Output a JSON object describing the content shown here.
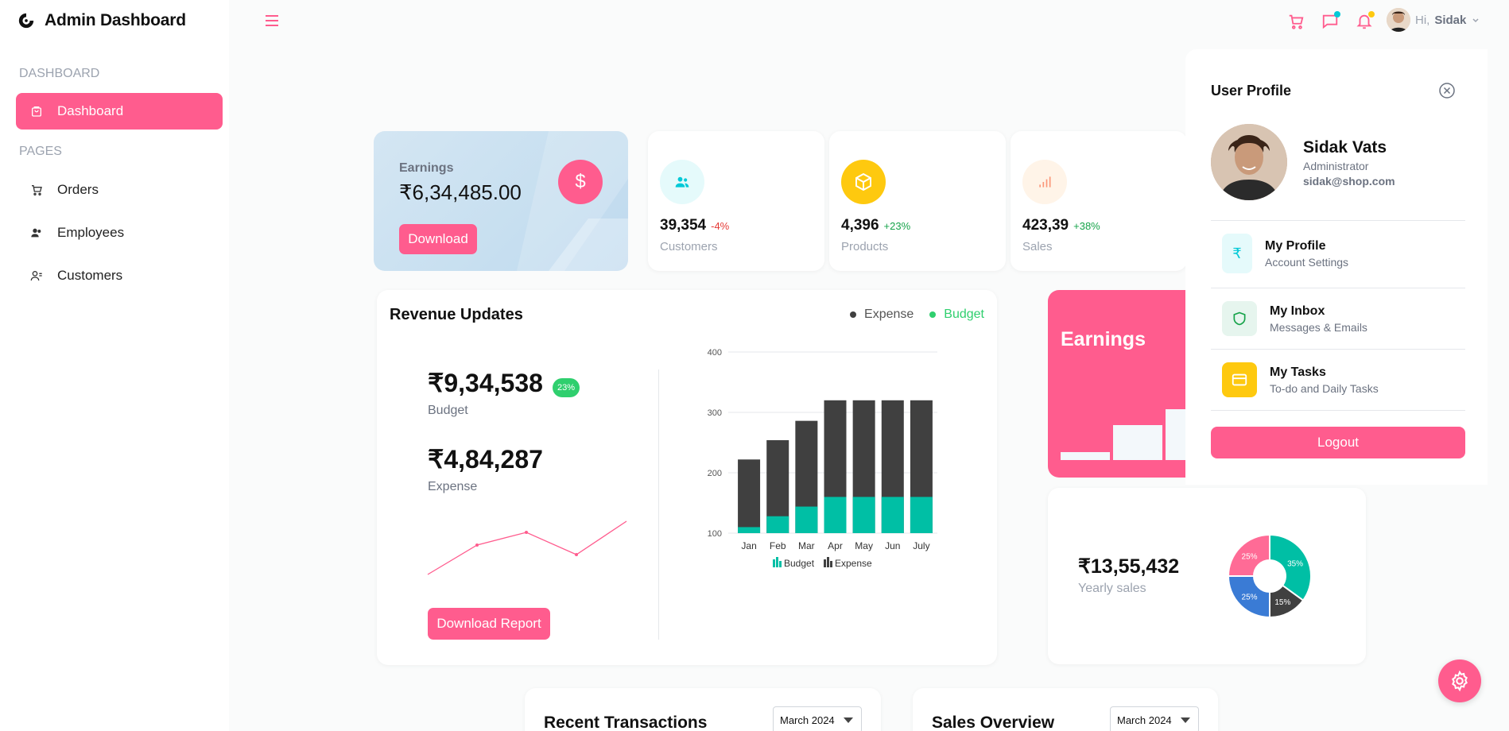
{
  "brand": {
    "title": "Admin Dashboard"
  },
  "sidebar": {
    "sections": [
      "DASHBOARD",
      "PAGES"
    ],
    "items": [
      {
        "label": "Dashboard",
        "icon": "shopping-bag-icon"
      },
      {
        "label": "Orders",
        "icon": "cart-icon"
      },
      {
        "label": "Employees",
        "icon": "employees-icon"
      },
      {
        "label": "Customers",
        "icon": "customers-icon"
      }
    ]
  },
  "header": {
    "greeting": "Hi,",
    "user": "Sidak",
    "icons": [
      "cart-icon",
      "chat-icon",
      "bell-icon"
    ]
  },
  "earnings_card": {
    "label": "Earnings",
    "value": "₹6,34,485.00",
    "button": "Download",
    "icon": "$"
  },
  "stats": [
    {
      "value": "39,354",
      "change": "-4%",
      "label": "Customers",
      "color": "#e53935"
    },
    {
      "value": "4,396",
      "change": "+23%",
      "label": "Products",
      "color": "#16a34a"
    },
    {
      "value": "423,39",
      "change": "+38%",
      "label": "Sales",
      "color": "#16a34a"
    }
  ],
  "revenue": {
    "title": "Revenue Updates",
    "legend": [
      "Expense",
      "Budget"
    ],
    "budget_value": "₹9,34,538",
    "budget_badge": "23%",
    "budget_label": "Budget",
    "expense_value": "₹4,84,287",
    "expense_label": "Expense",
    "button": "Download Report"
  },
  "chart_data": {
    "type": "bar",
    "stacked": true,
    "categories": [
      "Jan",
      "Feb",
      "Mar",
      "Apr",
      "May",
      "Jun",
      "July"
    ],
    "series": [
      {
        "name": "Budget",
        "values": [
          110,
          128,
          144,
          160,
          160,
          160,
          160
        ],
        "color": "#00bfa5"
      },
      {
        "name": "Expense",
        "values": [
          222,
          254,
          286,
          320,
          320,
          320,
          320
        ],
        "color": "#404040"
      }
    ],
    "ylim": [
      100,
      400
    ],
    "yticks": [
      100,
      200,
      300,
      400
    ],
    "legend": [
      "Budget",
      "Expense"
    ]
  },
  "earnings_pink": {
    "title": "Earnings"
  },
  "yearly": {
    "value": "₹13,55,432",
    "label": "Yearly sales",
    "pie": [
      {
        "label": "35%",
        "value": 35,
        "color": "#00bfa5"
      },
      {
        "label": "15%",
        "value": 15,
        "color": "#404040"
      },
      {
        "label": "25%",
        "value": 25,
        "color": "#3a7bd5"
      },
      {
        "label": "25%",
        "value": 25,
        "color": "#ff6b96"
      }
    ]
  },
  "bottom": [
    {
      "title": "Recent Transactions",
      "select": "March 2024"
    },
    {
      "title": "Sales Overview",
      "select": "March 2024"
    }
  ],
  "profile": {
    "heading": "User Profile",
    "name": "Sidak Vats",
    "role": "Administrator",
    "email": "sidak@shop.com",
    "items": [
      {
        "title": "My Profile",
        "sub": "Account Settings",
        "icon": "rupee-icon"
      },
      {
        "title": "My Inbox",
        "sub": "Messages & Emails",
        "icon": "shield-icon"
      },
      {
        "title": "My Tasks",
        "sub": "To-do and Daily Tasks",
        "icon": "card-icon"
      }
    ],
    "logout": "Logout"
  }
}
